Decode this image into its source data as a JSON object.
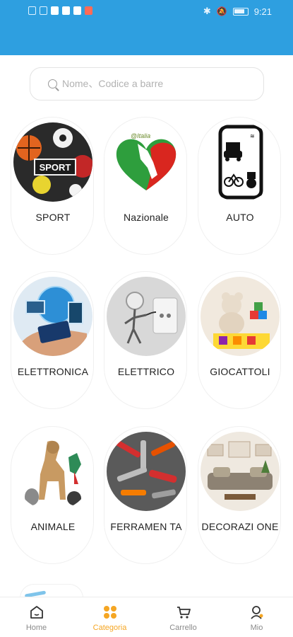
{
  "status_bar": {
    "time": "9:21",
    "icons": [
      "sim-icon",
      "wifi-icon",
      "app-icon",
      "message-icon",
      "mail-icon",
      "app-red-icon",
      "bluetooth-icon",
      "mute-icon",
      "battery-icon"
    ]
  },
  "search": {
    "placeholder": "Nome、Codice a barre"
  },
  "categories": [
    {
      "label": "SPORT",
      "icon": "sport-image"
    },
    {
      "label": "Nazionale",
      "icon": "italy-heart-image"
    },
    {
      "label": "AUTO",
      "icon": "auto-image"
    },
    {
      "label": "ELETTRONICA",
      "icon": "electronics-image"
    },
    {
      "label": "ELETTRICO",
      "icon": "electric-image"
    },
    {
      "label": "GIOCATTOLI",
      "icon": "toys-image"
    },
    {
      "label": "ANIMALE",
      "icon": "animals-image"
    },
    {
      "label": "FERRAMEN TA",
      "icon": "tools-image"
    },
    {
      "label": "DECORAZI ONE",
      "icon": "decor-image"
    }
  ],
  "nav": {
    "items": [
      {
        "label": "Home",
        "icon": "home-icon"
      },
      {
        "label": "Categoria",
        "icon": "category-icon"
      },
      {
        "label": "Carrello",
        "icon": "cart-icon"
      },
      {
        "label": "Mio",
        "icon": "profile-icon"
      }
    ],
    "active": "Categoria"
  },
  "colors": {
    "header": "#2e9fe0",
    "active_tab": "#f5a623",
    "inactive_tab": "#8a8a8a"
  }
}
